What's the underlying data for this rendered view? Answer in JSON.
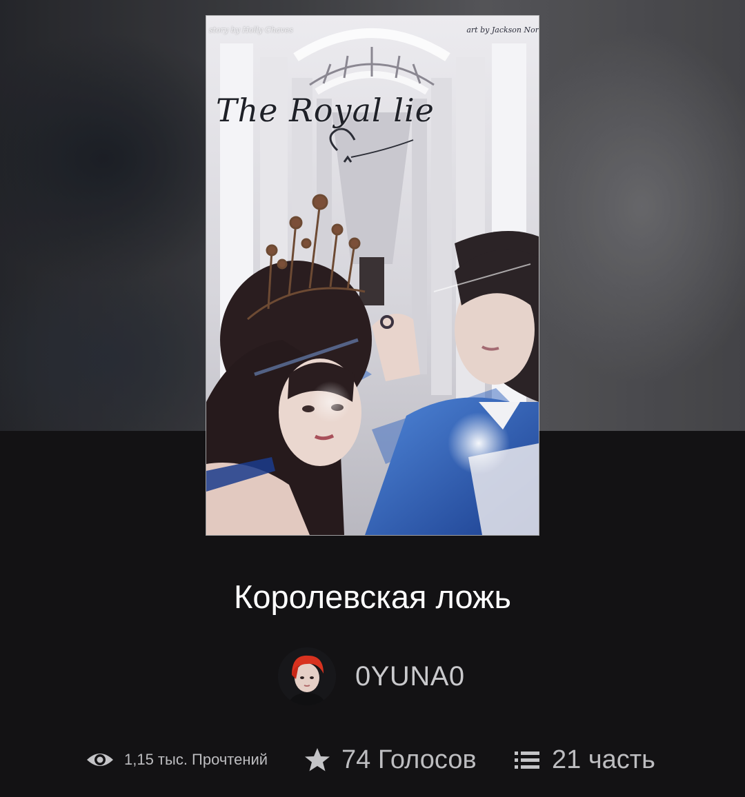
{
  "cover": {
    "credit_left": "story by Holly Chaves",
    "credit_right": "art by Jackson Nor",
    "title_art": "The Royal lie"
  },
  "story": {
    "title": "Королевская ложь"
  },
  "author": {
    "name": "0YUNA0"
  },
  "stats": {
    "reads": "1,15 тыс. Прочтений",
    "votes": "74 Голосов",
    "parts": "21 часть"
  },
  "icons": {
    "reads": "eye-icon",
    "votes": "star-icon",
    "parts": "list-icon"
  },
  "colors": {
    "background": "#131214",
    "title_text": "#ffffff",
    "secondary_text": "#bdbdc0"
  }
}
